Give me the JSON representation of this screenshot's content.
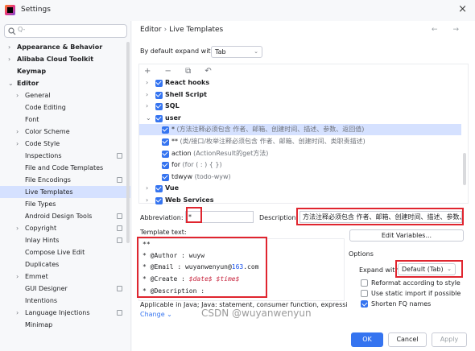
{
  "window": {
    "title": "Settings",
    "close_glyph": "×"
  },
  "sidebar": {
    "search_placeholder": "Q-",
    "items": [
      {
        "label": "Appearance & Behavior",
        "bold": true,
        "chev": "›"
      },
      {
        "label": "Alibaba Cloud Toolkit",
        "bold": true,
        "chev": "›"
      },
      {
        "label": "Keymap",
        "bold": true,
        "chev": ""
      },
      {
        "label": "Editor",
        "bold": true,
        "chev": "⌄"
      },
      {
        "label": "General",
        "bold": false,
        "chev": "›"
      },
      {
        "label": "Code Editing",
        "bold": false,
        "chev": ""
      },
      {
        "label": "Font",
        "bold": false,
        "chev": ""
      },
      {
        "label": "Color Scheme",
        "bold": false,
        "chev": "›"
      },
      {
        "label": "Code Style",
        "bold": false,
        "chev": "›"
      },
      {
        "label": "Inspections",
        "bold": false,
        "chev": "",
        "cfg": true
      },
      {
        "label": "File and Code Templates",
        "bold": false,
        "chev": ""
      },
      {
        "label": "File Encodings",
        "bold": false,
        "chev": "",
        "cfg": true
      },
      {
        "label": "Live Templates",
        "bold": false,
        "chev": "",
        "selected": true
      },
      {
        "label": "File Types",
        "bold": false,
        "chev": ""
      },
      {
        "label": "Android Design Tools",
        "bold": false,
        "chev": "",
        "cfg": true
      },
      {
        "label": "Copyright",
        "bold": false,
        "chev": "›",
        "cfg": true
      },
      {
        "label": "Inlay Hints",
        "bold": false,
        "chev": "",
        "cfg": true
      },
      {
        "label": "Compose Live Edit",
        "bold": false,
        "chev": ""
      },
      {
        "label": "Duplicates",
        "bold": false,
        "chev": ""
      },
      {
        "label": "Emmet",
        "bold": false,
        "chev": "›"
      },
      {
        "label": "GUI Designer",
        "bold": false,
        "chev": "",
        "cfg": true
      },
      {
        "label": "Intentions",
        "bold": false,
        "chev": ""
      },
      {
        "label": "Language Injections",
        "bold": false,
        "chev": "›",
        "cfg": true
      },
      {
        "label": "Minimap",
        "bold": false,
        "chev": ""
      }
    ],
    "help_glyph": "?"
  },
  "main": {
    "breadcrumb": {
      "parent": "Editor",
      "sep": "›",
      "current": "Live Templates"
    },
    "nav_arrows": "← →",
    "expand_label": "By default expand with",
    "expand_value": "Tab",
    "toolbar_icons": [
      "plus-icon",
      "minus-icon",
      "copy-icon",
      "undo-icon"
    ],
    "toolbar_glyphs": "+ − ⧉ ↶",
    "templates": [
      {
        "type": "group",
        "name": "React hooks",
        "chev": "›"
      },
      {
        "type": "group",
        "name": "Shell Script",
        "chev": "›"
      },
      {
        "type": "group",
        "name": "SQL",
        "chev": "›"
      },
      {
        "type": "group",
        "name": "user",
        "chev": "⌄"
      },
      {
        "type": "item",
        "abbr": "*",
        "desc": "(方法注释必须包含 作者、邮箱、创建时间、描述、参数、返回值)",
        "selected": true
      },
      {
        "type": "item",
        "abbr": "**",
        "desc": "(类/接口/枚举注释必须包含 作者、邮箱、创建时间、类职责描述)"
      },
      {
        "type": "item",
        "abbr": "action",
        "desc": "(ActionResult的get方法)"
      },
      {
        "type": "item",
        "abbr": "for",
        "desc": "(for ( : ) {       })"
      },
      {
        "type": "item",
        "abbr": "tdwyw",
        "desc": "(todo-wyw)"
      },
      {
        "type": "group",
        "name": "Vue",
        "chev": "›"
      },
      {
        "type": "group",
        "name": "Web Services",
        "chev": "›"
      }
    ],
    "abbreviation_label": "Abbreviation:",
    "abbreviation_value": "*",
    "description_label": "Description:",
    "description_value": "方法注释必须包含 作者、邮箱、创建时间、描述、参数、返回值",
    "template_text_label": "Template text:",
    "template_lines": [
      "**",
      " * @Author : wuyw",
      " * @Email : wuyanwenyun@163.com",
      " * @Create : $date$ $time$",
      " * @Description :"
    ],
    "applicable": "Applicable in Java; Java: statement, consumer function, expression, '...",
    "change_link": "Change ⌄",
    "edit_vars_label": "Edit Variables...",
    "options_label": "Options",
    "expand_with_label": "Expand with",
    "expand_with_value": "Default (Tab)",
    "options": [
      {
        "label": "Reformat according to style",
        "checked": false
      },
      {
        "label": "Use static import if possible",
        "checked": false
      },
      {
        "label": "Shorten FQ names",
        "checked": true
      }
    ],
    "ok_label": "OK",
    "cancel_label": "Cancel",
    "apply_label": "Apply"
  },
  "watermark": "CSDN @wuyanwenyun",
  "colors": {
    "accent": "#3574f0",
    "highlight": "#e0252f",
    "selection": "#d5e1ff"
  }
}
